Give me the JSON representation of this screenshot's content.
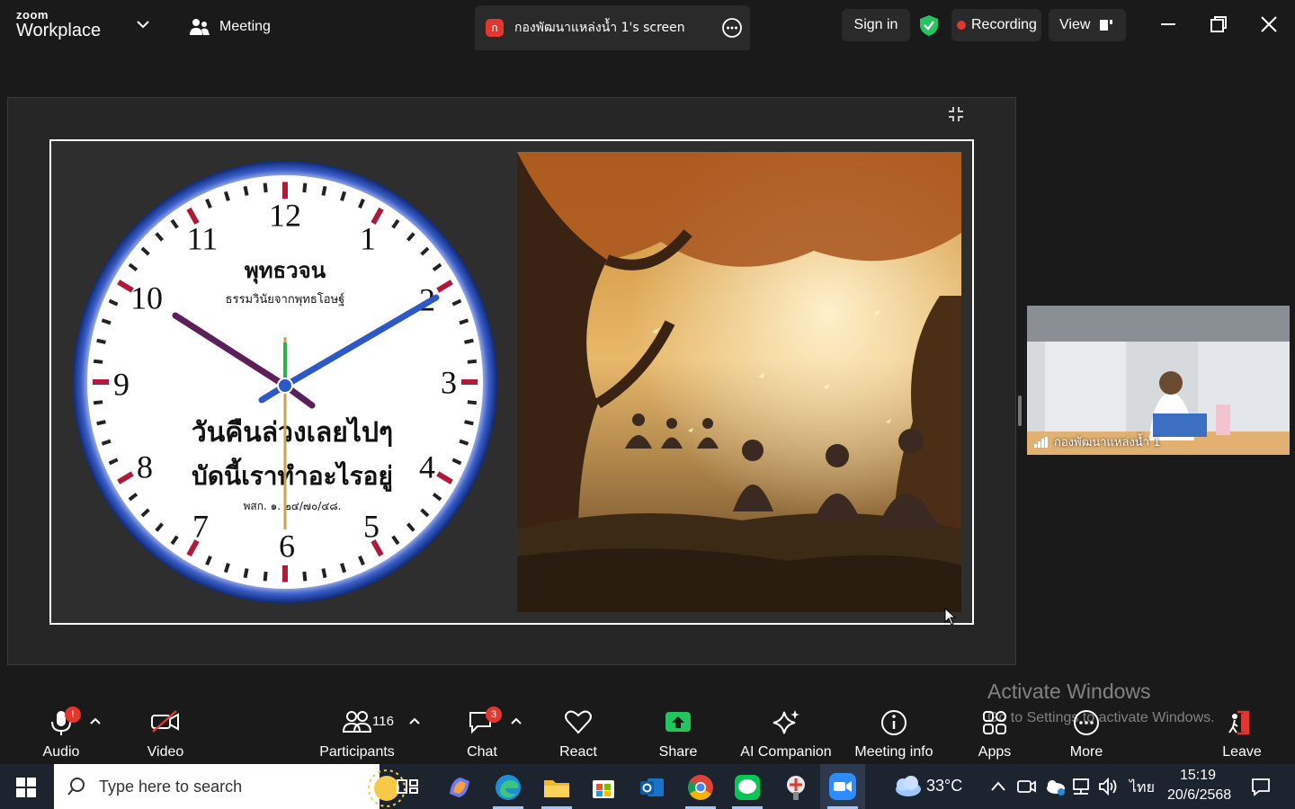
{
  "app": {
    "brand_top": "zoom",
    "brand_bottom": "Workplace",
    "meeting_label": "Meeting",
    "share_badge": "ก",
    "share_title": "กองพัฒนาแหล่งน้ำ 1's screen",
    "signin_label": "Sign in",
    "recording_label": "Recording",
    "view_label": "View"
  },
  "slide": {
    "clock_title": "พุทธวจน",
    "clock_subtitle": "ธรรมวินัยจากพุทธโอษฐ์",
    "clock_line1": "วันคืนล่วงเลยไปๆ",
    "clock_line2": "บัดนี้เราทำอะไรอยู่",
    "clock_ref": "พสก. ๑. ๒๔/๗๐/๔๘.",
    "numerals": [
      "12",
      "1",
      "2",
      "3",
      "4",
      "5",
      "6",
      "7",
      "8",
      "9",
      "10",
      "11"
    ]
  },
  "participant": {
    "name": "กองพัฒนาแหล่งน้ำ 1"
  },
  "watermark": {
    "line1": "Activate Windows",
    "line2": "Go to Settings to activate Windows."
  },
  "toolbar": {
    "audio": "Audio",
    "video": "Video",
    "participants": "Participants",
    "participants_count": "116",
    "chat": "Chat",
    "chat_badge": "3",
    "react": "React",
    "share": "Share",
    "ai_companion": "AI Companion",
    "meeting_info": "Meeting info",
    "apps": "Apps",
    "more": "More",
    "leave": "Leave",
    "audio_badge": "!"
  },
  "taskbar": {
    "search_placeholder": "Type here to search",
    "weather": "33°C",
    "language": "ไทย",
    "time": "15:19",
    "date": "20/6/2568"
  },
  "colors": {
    "accent_green": "#22c55e",
    "recording_red": "#e0382e",
    "clock_ring": "#1b3d8f",
    "hand_purple": "#5b1f5a",
    "hand_blue": "#2c58c8"
  }
}
